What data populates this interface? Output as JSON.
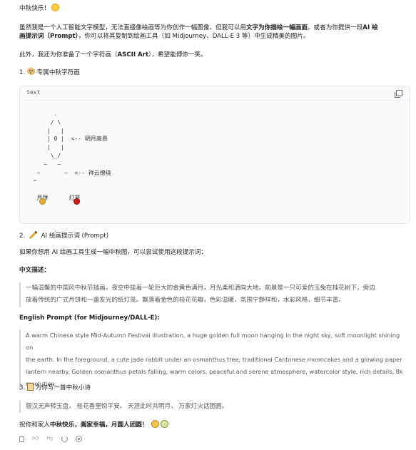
{
  "greeting": "中秋快乐！",
  "intro": {
    "line1_a": "虽然我是一个人工智能文字模型，无法直接像绘画等为你创作一幅图像，但我可以用",
    "line1_b": "文字为你描绘一幅画面",
    "line1_c": "，或者为你提供一段",
    "line1_d": "AI 绘",
    "line2_a": "画提示词（Prompt）",
    "line2_b": "，你可以将其复制到绘画工具（如 Midjourney、DALL-E 3 等）中生成精美的图片。"
  },
  "extra": {
    "a": "此外，我还为你准备了一个字符画（",
    "b": "ASCII Art",
    "c": "），希望能博你一笑。"
  },
  "section1": {
    "num": "1.",
    "title": "专属中秋字符画"
  },
  "code": {
    "lang": "text",
    "art": "        .\n       / \\\n      |   |\n      | 0 |  <-- 明月高悬\n      |   |\n       \\_/\n     ~   ~\n   ~       ~  <-- 祥云缭绕\n  ~\n\n   月饼      灯笼"
  },
  "section2": {
    "num": "2.",
    "title": "AI 绘画提示词 (Prompt)"
  },
  "prompt_intro": "如果你想用 AI 绘画工具生成一幅中秋图，可以尝试使用这段提示词：",
  "cn_label": "中文描述：",
  "cn_prompt": [
    "一幅温馨的中国风中秋节插画，夜空中挂着一轮巨大的金黄色满月，月光柔和洒向大地。前景是一只可爱的玉兔在桂花树下，旁边",
    "放着传统的广式月饼和一盏发光的纸灯笼。飘落着金色的桂花花瓣，色彩温暖，氛围宁静祥和，水彩风格，细节丰富。"
  ],
  "en_label": "English Prompt (for Midjourney/DALL-E):",
  "en_prompt": [
    "A warm Chinese style Mid-Autumn Festival illustration, a huge golden full moon hanging in the night sky, soft moonlight shining on",
    "the earth. In the foreground, a cute jade rabbit under an osmanthus tree, traditional Cantonese mooncakes and a glowing paper",
    "lantern nearby. Golden osmanthus petals falling, warm colors, peaceful and serene atmosphere, watercolor style, rich details, 8k",
    "resolution."
  ],
  "section3": {
    "num": "3.",
    "title": "为你写一首中秋小诗"
  },
  "poem": "银汉无声转玉盘，  桂花香里悦平安。  天涯此时共明月，  万家灯火话团圆。",
  "closing": {
    "a": "祝你和家人",
    "b": "中秋快乐，阖家幸福，月圆人团圆！"
  },
  "colors": {
    "moon": "#ffcf3f",
    "lantern": "#d0161b",
    "mooncake": "#e8b230",
    "quote_border": "#d4d4d8"
  },
  "icons": [
    "copy-icon",
    "thumbs-up-icon",
    "thumbs-down-icon",
    "refresh-icon",
    "share-icon"
  ]
}
